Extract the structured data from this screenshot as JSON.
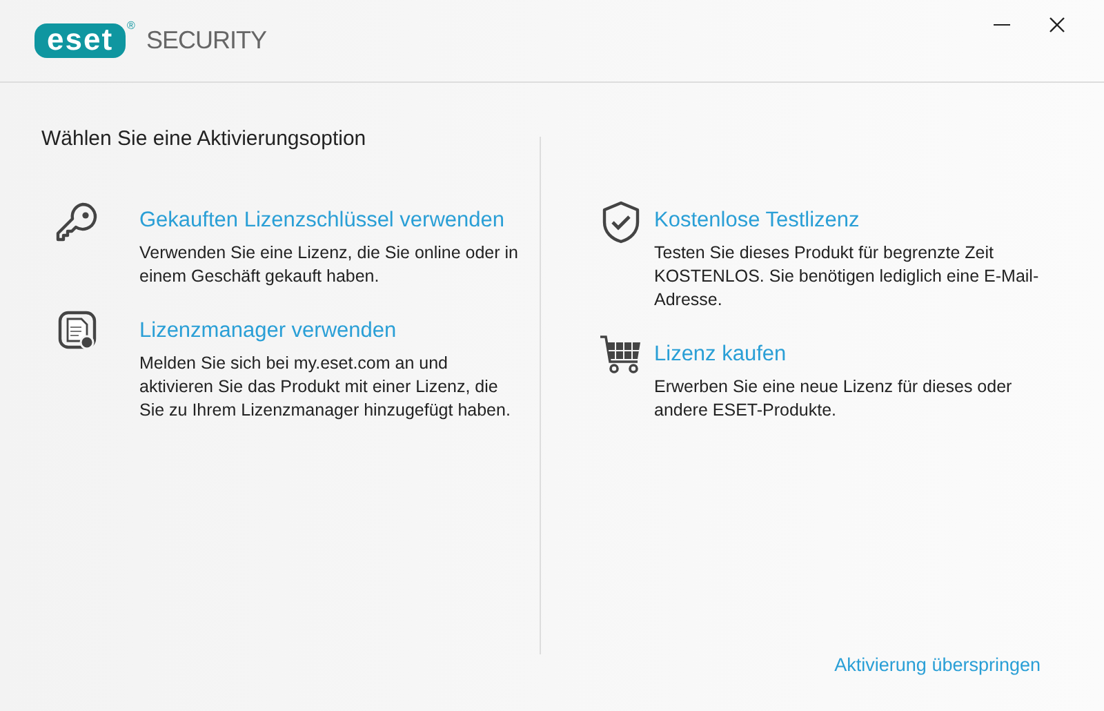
{
  "header": {
    "logo": "eset",
    "logo_mark": "®",
    "product": "SECURITY",
    "controls": [
      {
        "kind": "minimize"
      },
      {
        "kind": "close"
      }
    ]
  },
  "heading": "Wählen Sie eine Aktivierungsoption",
  "columns": [
    {
      "options": [
        {
          "kind": "key",
          "title": "Gekauften Lizenzschlüssel verwenden",
          "description": "Verwenden Sie eine Lizenz, die Sie online oder in einem Geschäft gekauft haben."
        },
        {
          "kind": "document",
          "title": "Lizenzmanager verwenden",
          "description": "Melden Sie sich bei my.eset.com an und aktivieren Sie das Produkt mit einer Lizenz, die Sie zu Ihrem Lizenzmanager hinzugefügt haben."
        }
      ]
    },
    {
      "options": [
        {
          "kind": "shield",
          "title": "Kostenlose Testlizenz",
          "description": "Testen Sie dieses Produkt für begrenzte Zeit KOSTENLOS. Sie benötigen lediglich eine E-Mail-Adresse."
        },
        {
          "kind": "cart",
          "title": "Lizenz kaufen",
          "description": "Erwerben Sie eine neue Lizenz für dieses oder andere ESET-Produkte."
        }
      ]
    }
  ],
  "skip_link": "Aktivierung überspringen"
}
